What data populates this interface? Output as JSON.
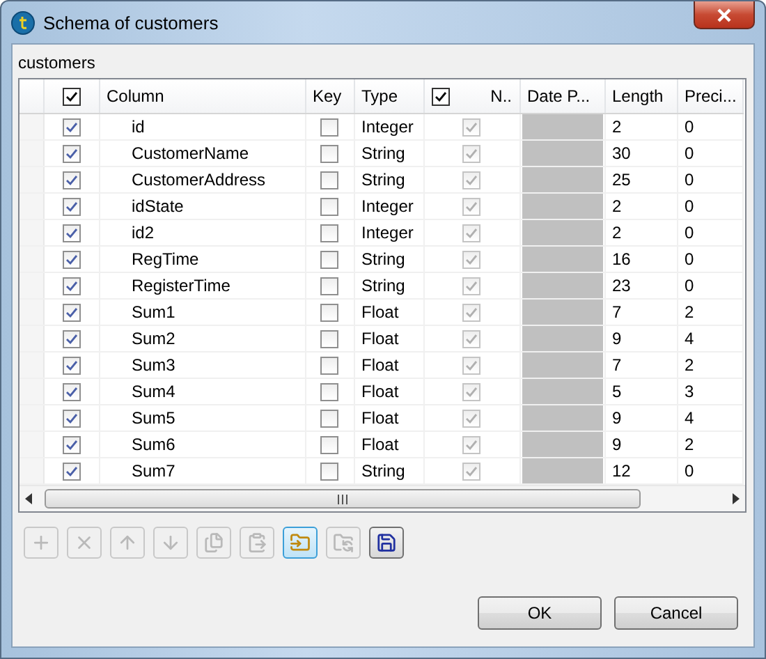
{
  "window": {
    "title": "Schema of customers"
  },
  "schema": {
    "label": "customers",
    "columns": [
      {
        "kind": "check",
        "checked": true
      },
      {
        "kind": "text",
        "label": "Column"
      },
      {
        "kind": "text",
        "label": "Key"
      },
      {
        "kind": "text",
        "label": "Type"
      },
      {
        "kind": "check_label",
        "checked": true,
        "label": "N.."
      },
      {
        "kind": "text",
        "label": "Date P..."
      },
      {
        "kind": "text",
        "label": "Length"
      },
      {
        "kind": "text",
        "label": "Preci..."
      }
    ],
    "rows": [
      {
        "used": true,
        "name": "id",
        "key": false,
        "type": "Integer",
        "nullable": true,
        "length": "2",
        "precision": "0"
      },
      {
        "used": true,
        "name": "CustomerName",
        "key": false,
        "type": "String",
        "nullable": true,
        "length": "30",
        "precision": "0"
      },
      {
        "used": true,
        "name": "CustomerAddress",
        "key": false,
        "type": "String",
        "nullable": true,
        "length": "25",
        "precision": "0"
      },
      {
        "used": true,
        "name": "idState",
        "key": false,
        "type": "Integer",
        "nullable": true,
        "length": "2",
        "precision": "0"
      },
      {
        "used": true,
        "name": "id2",
        "key": false,
        "type": "Integer",
        "nullable": true,
        "length": "2",
        "precision": "0"
      },
      {
        "used": true,
        "name": "RegTime",
        "key": false,
        "type": "String",
        "nullable": true,
        "length": "16",
        "precision": "0"
      },
      {
        "used": true,
        "name": "RegisterTime",
        "key": false,
        "type": "String",
        "nullable": true,
        "length": "23",
        "precision": "0"
      },
      {
        "used": true,
        "name": "Sum1",
        "key": false,
        "type": "Float",
        "nullable": true,
        "length": "7",
        "precision": "2"
      },
      {
        "used": true,
        "name": "Sum2",
        "key": false,
        "type": "Float",
        "nullable": true,
        "length": "9",
        "precision": "4"
      },
      {
        "used": true,
        "name": "Sum3",
        "key": false,
        "type": "Float",
        "nullable": true,
        "length": "7",
        "precision": "2"
      },
      {
        "used": true,
        "name": "Sum4",
        "key": false,
        "type": "Float",
        "nullable": true,
        "length": "5",
        "precision": "3"
      },
      {
        "used": true,
        "name": "Sum5",
        "key": false,
        "type": "Float",
        "nullable": true,
        "length": "9",
        "precision": "4"
      },
      {
        "used": true,
        "name": "Sum6",
        "key": false,
        "type": "Float",
        "nullable": true,
        "length": "9",
        "precision": "2"
      },
      {
        "used": true,
        "name": "Sum7",
        "key": false,
        "type": "String",
        "nullable": true,
        "length": "12",
        "precision": "0"
      }
    ]
  },
  "toolbar": [
    {
      "disabled": true,
      "highlighted": false
    },
    {
      "disabled": true,
      "highlighted": false
    },
    {
      "disabled": true,
      "highlighted": false
    },
    {
      "disabled": true,
      "highlighted": false
    },
    {
      "disabled": true,
      "highlighted": false
    },
    {
      "disabled": true,
      "highlighted": false
    },
    {
      "disabled": false,
      "highlighted": true
    },
    {
      "disabled": true,
      "highlighted": false
    },
    {
      "disabled": false,
      "highlighted": false
    }
  ],
  "buttons": [
    {
      "label": "OK"
    },
    {
      "label": "Cancel"
    }
  ]
}
